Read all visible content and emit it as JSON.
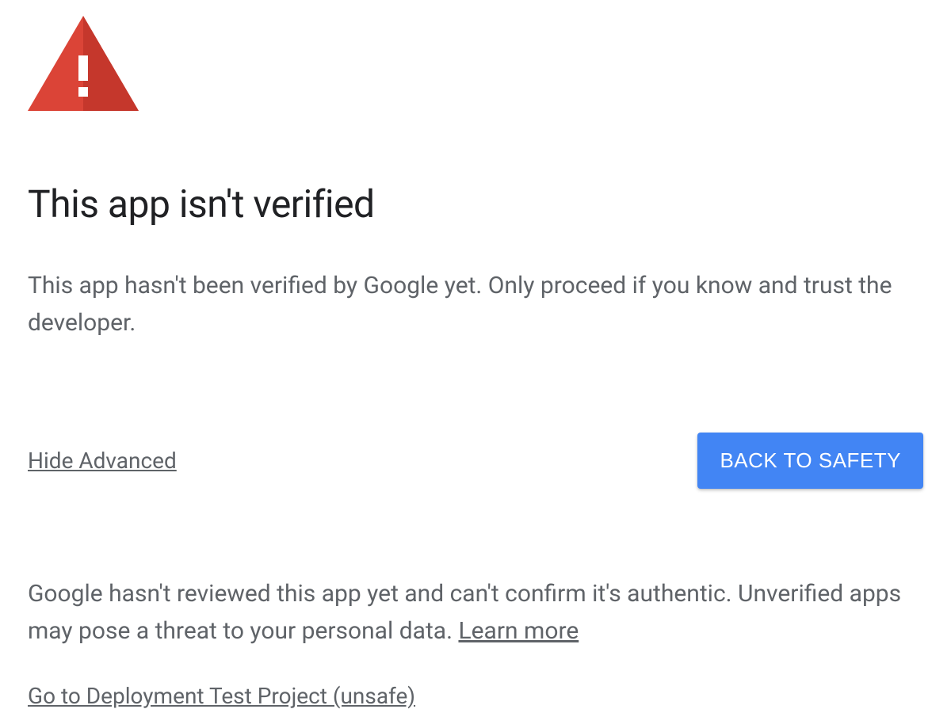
{
  "warning": {
    "heading": "This app isn't verified",
    "description": "This app hasn't been verified by Google yet. Only proceed if you know and trust the developer."
  },
  "actions": {
    "toggle_advanced_label": "Hide Advanced",
    "back_to_safety_label": "BACK TO SAFETY"
  },
  "advanced": {
    "body_text": "Google hasn't reviewed this app yet and can't confirm it's authentic. Unverified apps may pose a threat to your personal data. ",
    "learn_more_label": "Learn more",
    "proceed_label": "Go to Deployment Test Project (unsafe)"
  },
  "colors": {
    "warning_red": "#d93025",
    "button_blue": "#4285f4",
    "text_gray": "#5f6368",
    "heading_black": "#202124"
  }
}
